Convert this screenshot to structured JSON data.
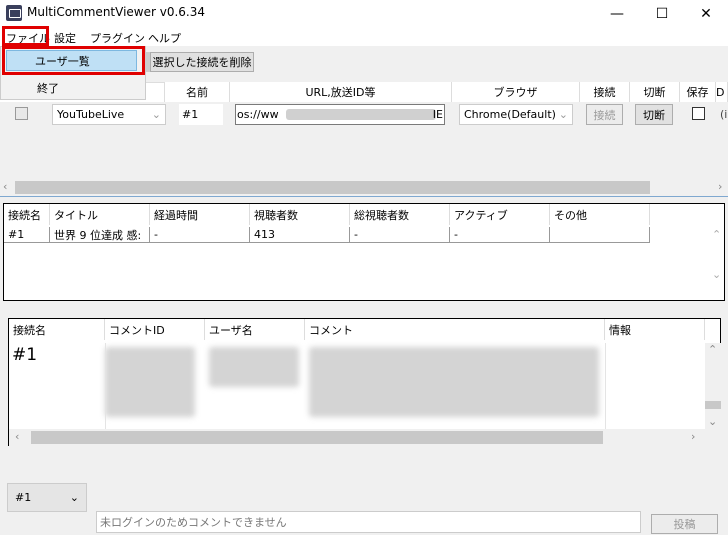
{
  "window": {
    "title": "MultiCommentViewer v0.6.34",
    "minimize": "—",
    "maximize": "☐",
    "close": "✕"
  },
  "menu": {
    "file": "ファイル",
    "settings": "設定",
    "plugins": "プラグイン",
    "help": "ヘルプ"
  },
  "file_menu": {
    "user_list": "ユーザ一覧",
    "exit": "終了"
  },
  "toolbar": {
    "delete_selected": "選択した接続を削除"
  },
  "connections": {
    "headers": {
      "name": "名前",
      "url": "URL,放送ID等",
      "browser": "ブラウザ",
      "connect": "接続",
      "disconnect": "切断",
      "save": "保存",
      "d": "D"
    },
    "row": {
      "site": "YouTubeLive",
      "name": "#1",
      "url": "os://ww",
      "url_tail": "IE",
      "browser": "Chrome(Default)",
      "connect": "接続",
      "disconnect": "切断",
      "d": "(i"
    }
  },
  "meta_table": {
    "headers": [
      "接続名",
      "タイトル",
      "経過時間",
      "視聴者数",
      "総視聴者数",
      "アクティブ",
      "その他"
    ],
    "row": [
      "#1",
      "世界 9 位達成 感:",
      "-",
      "413",
      "-",
      "-",
      ""
    ]
  },
  "comment_table": {
    "headers": [
      "接続名",
      "コメントID",
      "ユーザ名",
      "コメント",
      "情報"
    ],
    "row_name": "#1"
  },
  "footer": {
    "selector": "#1",
    "comment_placeholder": "未ログインのためコメントできません",
    "post": "投稿"
  }
}
